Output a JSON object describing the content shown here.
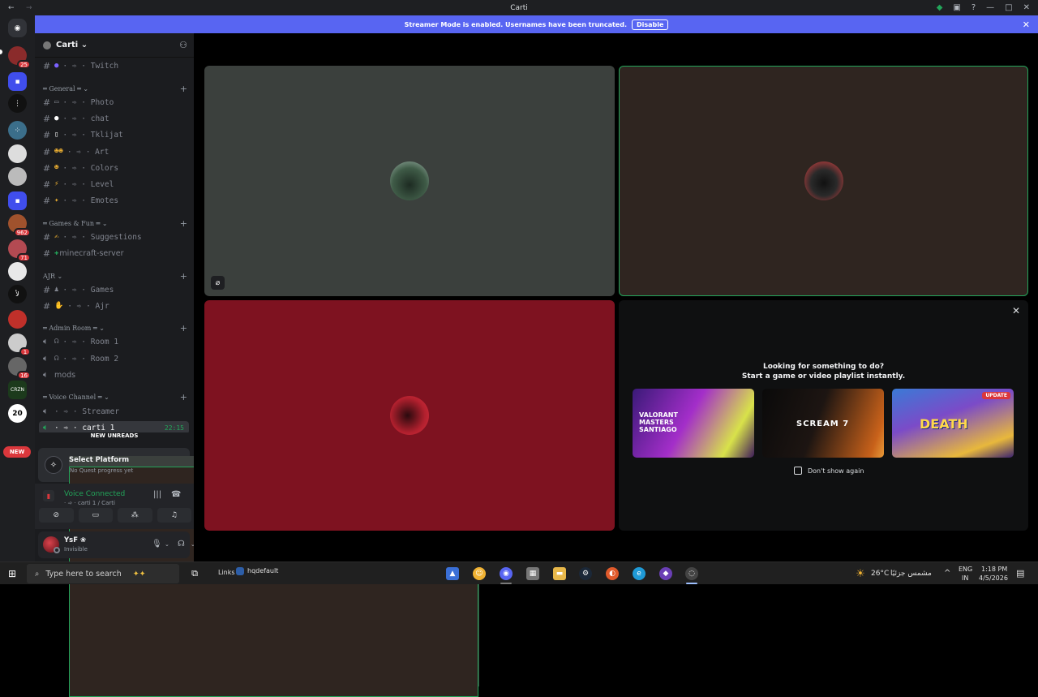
{
  "titlebar": {
    "title": "Carti",
    "back": "←",
    "forward": "→"
  },
  "banner": {
    "text": "Streamer Mode is enabled. Usernames have been truncated.",
    "disable_label": "Disable",
    "close": "✕"
  },
  "guilds": {
    "badges": [
      "25",
      "962",
      "71",
      "1",
      "16"
    ],
    "text_icons": [
      "لأ",
      "20",
      "CRZN"
    ],
    "new_label": "NEW"
  },
  "server": {
    "name": "Carti ⌄"
  },
  "channels": {
    "twitch": "· ➾ · Twitch",
    "cat_general": "═ General ═ ⌄",
    "photo": "· ➾ · Photo",
    "chat": "· ➾ · chat",
    "tklijat": "· ➾ · Tklijat",
    "art": "· ➾ · Art",
    "colors": "· ➾ · Colors",
    "level": "· ➾ · Level",
    "emotes": "· ➾ · Emotes",
    "cat_games": "═ Games & Fun ═ ⌄",
    "suggestions": "· ➾ · Suggestions",
    "minecraft": "minecraft-server",
    "cat_ajr": "AJR ⌄",
    "games": "· ➾ · Games",
    "ajr": "· ➾ · Ajr",
    "cat_admin": "═ Admin Room ═ ⌄",
    "room1": "· ➾ · Room 1",
    "room2": "· ➾ · Room 2",
    "mods": "mods",
    "cat_voice": "═ Voice Channel ═ ⌄",
    "streamer": "· ➾ · Streamer",
    "carti1": "· ➾ · carti 1",
    "carti1_time": "22:15",
    "new_unreads": "NEW UNREADS"
  },
  "quest": {
    "title": "Select Platform",
    "subtitle": "No Quest progress yet"
  },
  "voice": {
    "status": "Voice Connected",
    "sub": "· ➾ · carti 1 / Carti"
  },
  "user": {
    "name": "YsF ❀",
    "status": "Invisible"
  },
  "activity": {
    "line1": "Looking for something to do?",
    "line2": "Start a game or video playlist instantly.",
    "cards": [
      "VALORANT MASTERS SANTIAGO",
      "SCREAM 7",
      "DEATH"
    ],
    "update": "UPDATE",
    "dont_show": "Don't show again"
  },
  "taskbar": {
    "search_placeholder": "Type here to search",
    "links": "Links",
    "hqdefault": "hqdefault",
    "weather": "26°C",
    "weather_text": "مشمس جزئيًا",
    "lang1": "ENG",
    "lang2": "IN",
    "time": "1:18 PM",
    "date": "4/5/2026"
  },
  "colors": {
    "accent": "#5865f2",
    "green": "#23a55a",
    "red": "#da373c"
  }
}
